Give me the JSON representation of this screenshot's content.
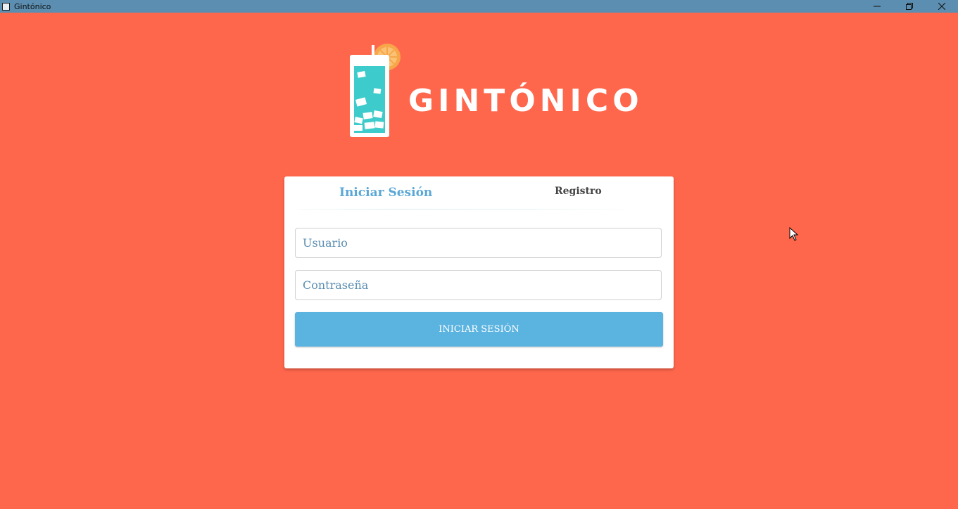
{
  "window": {
    "title": "Gintónico",
    "controls": {
      "minimize_icon": "minimize-icon",
      "restore_icon": "restore-icon",
      "close_icon": "close-icon"
    }
  },
  "brand": {
    "wordmark": "GINTÓNICO",
    "logo_icon": "gin-tonic-glass-icon",
    "colors": {
      "background": "#ff674d",
      "glass_liquid": "#3ecbcb",
      "lemon": "#f7a64a",
      "accent_blue": "#5bb3e0"
    }
  },
  "tabs": {
    "login": "Iniciar Sesión",
    "register": "Registro",
    "active": "login"
  },
  "form": {
    "username_placeholder": "Usuario",
    "password_placeholder": "Contraseña",
    "submit_label": "INICIAR SESIÓN"
  }
}
